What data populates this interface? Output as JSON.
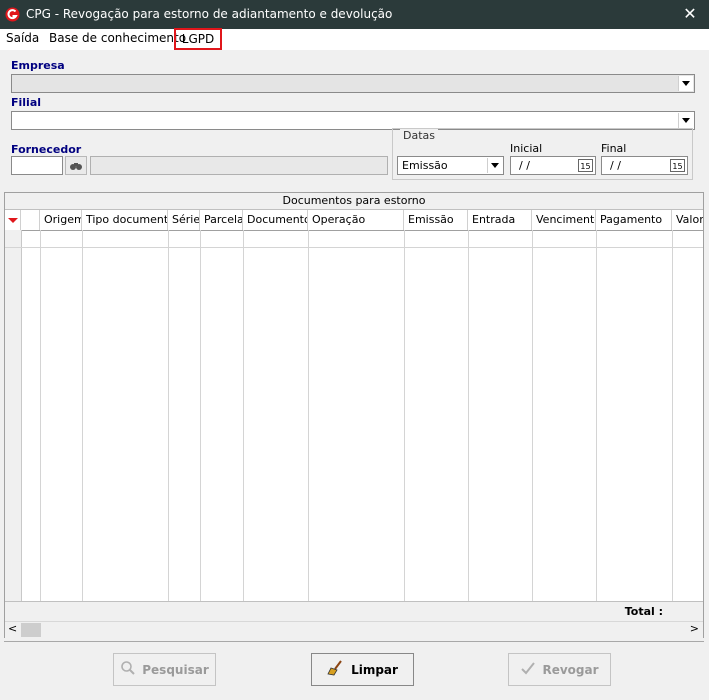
{
  "window": {
    "title": "CPG - Revogação para estorno de adiantamento e devolução",
    "close_glyph": "✕",
    "logo_icon": "app-logo-icon"
  },
  "menu": {
    "items": [
      "Saída",
      "Base de conhecimento",
      "LGPD"
    ],
    "highlight_color": "#e0161b"
  },
  "form": {
    "empresa_label": "Empresa",
    "filial_label": "Filial",
    "fornecedor_label": "Fornecedor",
    "fornecedor_code": "",
    "fornecedor_name": "",
    "datas_label": "Datas",
    "datas_type_value": "Emissão",
    "inicial_label": "Inicial",
    "inicial_value": "/ /",
    "final_label": "Final",
    "final_value": "/ /",
    "calendar_glyph": "15"
  },
  "grid": {
    "caption": "Documentos para estorno",
    "columns": [
      "Origem",
      "Tipo documento",
      "Série",
      "Parcela",
      "Documento",
      "Operação",
      "Emissão",
      "Entrada",
      "Vencimento",
      "Pagamento",
      "Valor"
    ],
    "total_label": "Total :",
    "scroll_left": "<",
    "scroll_right": ">"
  },
  "buttons": {
    "pesquisar": "Pesquisar",
    "limpar": "Limpar",
    "revogar": "Revogar"
  },
  "colors": {
    "titlebar": "#2b3a3a",
    "label_blue": "#000080",
    "sort_arrow": "#e0161b"
  }
}
